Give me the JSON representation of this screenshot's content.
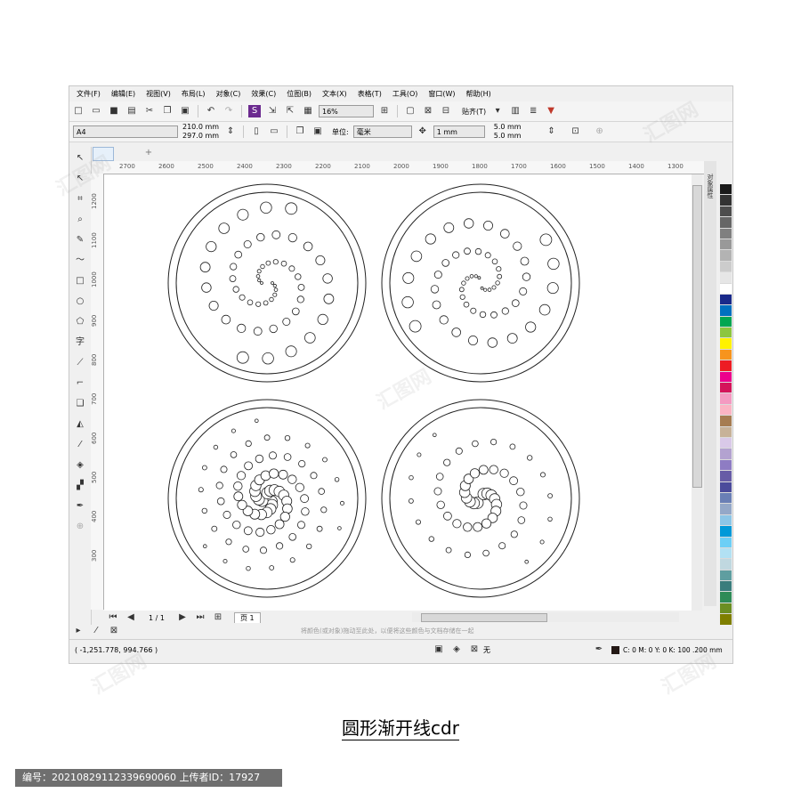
{
  "menu": [
    "文件(F)",
    "编辑(E)",
    "视图(V)",
    "布局(L)",
    "对象(C)",
    "效果(C)",
    "位图(B)",
    "文本(X)",
    "表格(T)",
    "工具(O)",
    "窗口(W)",
    "帮助(H)"
  ],
  "toolbar": {
    "zoom": "16%",
    "snap_label": "贴齐(T)"
  },
  "propbar": {
    "page_size": "A4",
    "width": "210.0 mm",
    "height": "297.0 mm",
    "unit_label": "单位:",
    "unit_value": "毫米",
    "nudge": "1 mm",
    "dup_x": "5.0 mm",
    "dup_y": "5.0 mm"
  },
  "hruler_ticks": [
    "2700",
    "2600",
    "2500",
    "2400",
    "2300",
    "2200",
    "2100",
    "2000",
    "1900",
    "1800",
    "1700",
    "1600",
    "1500",
    "1400",
    "1300"
  ],
  "vruler_ticks": [
    "1200",
    "1100",
    "1000",
    "900",
    "800",
    "700",
    "600",
    "500",
    "400",
    "300"
  ],
  "docker": {
    "label": "对象属性"
  },
  "pagebar": {
    "page_count": "1 / 1",
    "page_tab": "页 1"
  },
  "hint": "将颜色(或对象)拖动至此处，以便将这些颜色与文档存储在一起",
  "status": {
    "coords": "( -1,251.778, 994.766 )",
    "fill_label": "无",
    "outline_info": "C: 0 M: 0 Y: 0 K: 100  .200 mm"
  },
  "palette": [
    "#1a1a1a",
    "#333333",
    "#4d4d4d",
    "#666666",
    "#808080",
    "#999999",
    "#b3b3b3",
    "#cccccc",
    "#e6e6e6",
    "#ffffff",
    "#1a2a8a",
    "#0070c0",
    "#00a651",
    "#8dc63f",
    "#fff200",
    "#f7941d",
    "#ed1c24",
    "#ec008c",
    "#d4145a",
    "#f49ac1",
    "#fbb4c4",
    "#a67c52",
    "#c7b299",
    "#d9c9e8",
    "#b3a2d0",
    "#8e7cc3",
    "#675ca6",
    "#4b4b9b",
    "#6a7fb5",
    "#94a8c8",
    "#8cc6e7",
    "#0099d8",
    "#6dcff6",
    "#b2e1f3",
    "#c0d8e0",
    "#5f9ea0",
    "#3a7d7c",
    "#2e8b57",
    "#6b8e23",
    "#7f7f00"
  ],
  "caption": "圆形渐开线cdr",
  "badge": "编号：20210829112339690060 上传者ID：17927",
  "watermark": "汇图网"
}
